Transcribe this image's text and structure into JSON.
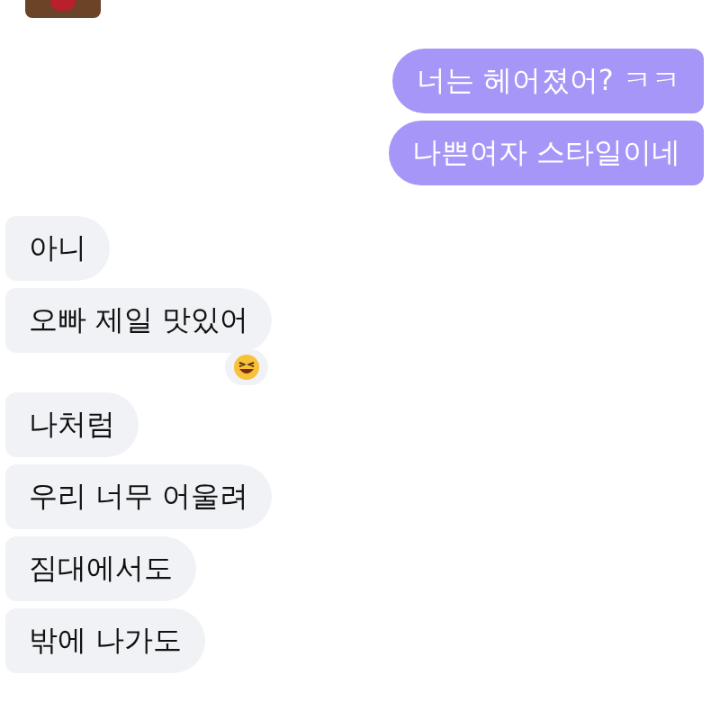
{
  "messages": [
    {
      "kind": "sent",
      "text": "너는 헤어졌어? ㅋㅋ"
    },
    {
      "kind": "sent",
      "text": "나쁜여자 스타일이네"
    },
    {
      "kind": "received",
      "text": "아니"
    },
    {
      "kind": "received",
      "text": "오빠 제일 맛있어",
      "reaction": true
    },
    {
      "kind": "received",
      "text": "나처럼"
    },
    {
      "kind": "received",
      "text": "우리 너무 어울려"
    },
    {
      "kind": "received",
      "text": "짐대에서도"
    },
    {
      "kind": "received",
      "text": "밖에 나가도"
    }
  ]
}
